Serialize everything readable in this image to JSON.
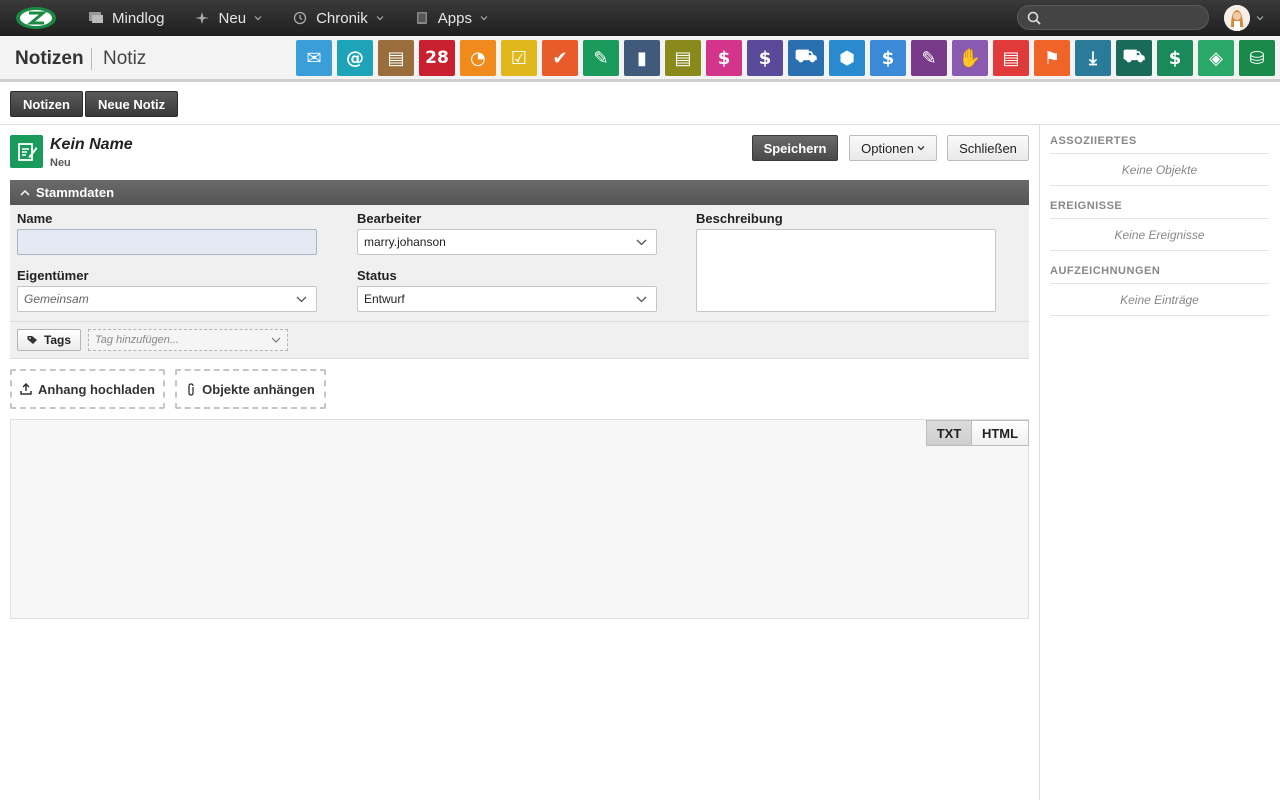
{
  "topnav": {
    "items": [
      {
        "label": "Mindlog",
        "icon": "monitor-icon"
      },
      {
        "label": "Neu",
        "icon": "sparkle-icon"
      },
      {
        "label": "Chronik",
        "icon": "history-icon"
      },
      {
        "label": "Apps",
        "icon": "tablet-icon"
      }
    ],
    "search_placeholder": ""
  },
  "header": {
    "module": "Notizen",
    "page": "Notiz",
    "apps": [
      {
        "name": "email-app-icon",
        "color": "#3a9fd9"
      },
      {
        "name": "contacts-app-icon",
        "color": "#1ea4b8"
      },
      {
        "name": "addressbook-app-icon",
        "color": "#9a6d3c"
      },
      {
        "name": "calendar-app-icon",
        "color": "#c8202f"
      },
      {
        "name": "timer-app-icon",
        "color": "#f08a1c"
      },
      {
        "name": "tasks-app-icon",
        "color": "#e0b81c"
      },
      {
        "name": "projects-app-icon",
        "color": "#e85c2c"
      },
      {
        "name": "notes-app-icon",
        "color": "#1a9b5b"
      },
      {
        "name": "bookmark-app-icon",
        "color": "#3f5a7a"
      },
      {
        "name": "documents-app-icon",
        "color": "#8a8a1c"
      },
      {
        "name": "sales-app-icon",
        "color": "#d4348a"
      },
      {
        "name": "finance-app-icon",
        "color": "#5a4a9a"
      },
      {
        "name": "delivery-app-icon",
        "color": "#2a6fb0"
      },
      {
        "name": "support-app-icon",
        "color": "#2a8ad0"
      },
      {
        "name": "budget-app-icon",
        "color": "#3a8ad8"
      },
      {
        "name": "contracts-app-icon",
        "color": "#7a3a8a"
      },
      {
        "name": "partners-app-icon",
        "color": "#8a5ab0"
      },
      {
        "name": "invoices-app-icon",
        "color": "#e03a3a"
      },
      {
        "name": "campaigns-app-icon",
        "color": "#f0642a"
      },
      {
        "name": "downloads-app-icon",
        "color": "#2a7a9a"
      },
      {
        "name": "shop-app-icon",
        "color": "#1a6a5a"
      },
      {
        "name": "payments-app-icon",
        "color": "#1a8a5a"
      },
      {
        "name": "pricing-app-icon",
        "color": "#2aa86a"
      },
      {
        "name": "database-app-icon",
        "color": "#1a8a4a"
      }
    ]
  },
  "actions": {
    "notes": "Notizen",
    "new_note": "Neue Notiz"
  },
  "record": {
    "title": "Kein Name",
    "subtitle": "Neu"
  },
  "buttons": {
    "save": "Speichern",
    "options": "Optionen",
    "close": "Schließen"
  },
  "section": {
    "title": "Stammdaten"
  },
  "form": {
    "name_label": "Name",
    "name_value": "",
    "assignee_label": "Bearbeiter",
    "assignee_value": "marry.johanson",
    "description_label": "Beschreibung",
    "owner_label": "Eigentümer",
    "owner_value": "Gemeinsam",
    "status_label": "Status",
    "status_value": "Entwurf"
  },
  "tags": {
    "label": "Tags",
    "placeholder": "Tag hinzufügen..."
  },
  "attachments": {
    "upload": "Anhang hochladen",
    "attach_objects": "Objekte anhängen"
  },
  "editor": {
    "tab_txt": "TXT",
    "tab_html": "HTML"
  },
  "right": {
    "associated": {
      "title": "ASSOZIIERTES",
      "empty": "Keine Objekte"
    },
    "events": {
      "title": "EREIGNISSE",
      "empty": "Keine Ereignisse"
    },
    "records": {
      "title": "AUFZEICHNUNGEN",
      "empty": "Keine Einträge"
    }
  }
}
